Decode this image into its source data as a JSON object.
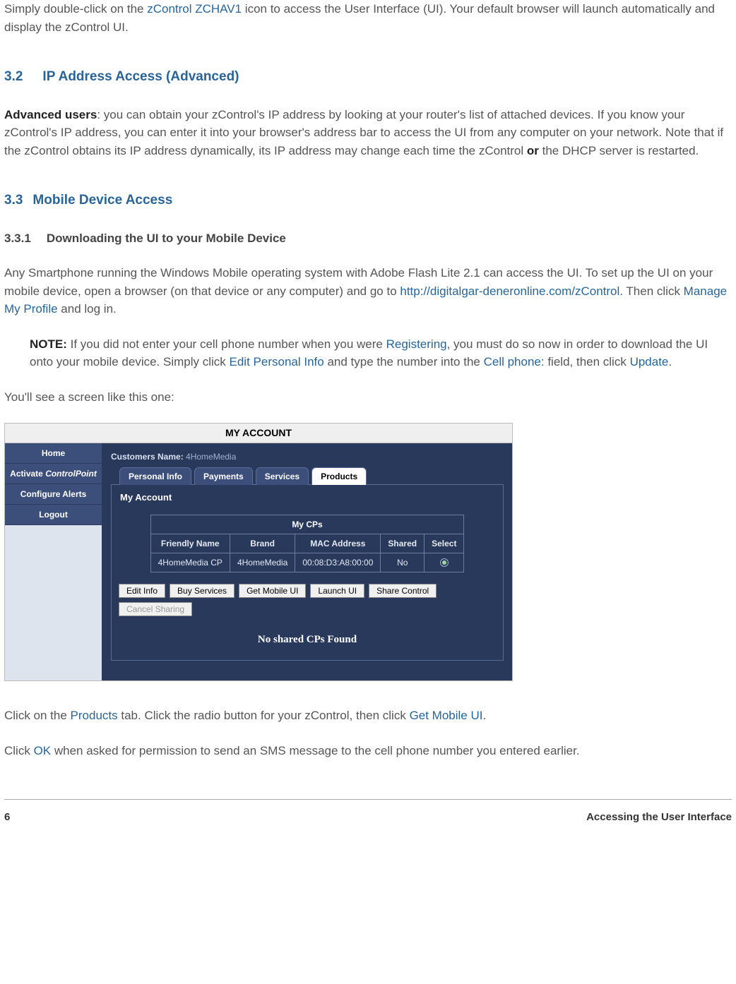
{
  "intro": {
    "pre": "Simply double-click on the ",
    "link": "zControl ZCHAV1",
    "post": " icon to access the User Interface (UI). Your default browser will launch automatically and display the zControl UI."
  },
  "s32": {
    "num": "3.2",
    "title": "IP Address Access (Advanced)",
    "strong": "Advanced users",
    "body1": ": you can obtain your zControl's IP address by looking at your router's list of attached devices. If you know your zControl's IP address, you can enter it into your browser's address bar to access the UI from any computer on your network. Note that if the zControl obtains its IP address dynamically, its IP address may change each time the zControl ",
    "or": "or",
    "body2": " the DHCP server is restarted."
  },
  "s33": {
    "num": "3.3",
    "title": "Mobile Device Access"
  },
  "s331": {
    "num": "3.3.1",
    "title": "Downloading the UI to your Mobile Device",
    "p1a": "Any Smartphone running the Windows Mobile operating system with Adobe Flash Lite 2.1 can access the UI. To set up the UI on your mobile device, open a browser (on that device or any computer) and go to ",
    "url": "http://digitalgar-deneronline.com/zControl.",
    "p1b": " Then click ",
    "manage": "Manage My Profile",
    "p1c": " and log in.",
    "note_label": "NOTE:",
    "note_a": " If you did not enter your cell phone number when you were ",
    "registering": "Registering",
    "note_b": ", you must do so now in order to download the UI onto your mobile device. Simply click ",
    "edit_personal": "Edit Personal Info",
    "note_c": " and type the number into the ",
    "cellphone": "Cell phone:",
    "note_d": " field, then click ",
    "update": "Update",
    "note_e": ".",
    "p2": "You'll see a screen like this one:"
  },
  "shot": {
    "title": "MY ACCOUNT",
    "sidebar": {
      "home": "Home",
      "activate_pre": "Activate ",
      "activate_em": "ControlPoint",
      "configure": "Configure Alerts",
      "logout": "Logout"
    },
    "cust_label": "Customers Name: ",
    "cust_val": "4HomeMedia",
    "tabs": {
      "personal": "Personal Info",
      "payments": "Payments",
      "services": "Services",
      "products": "Products"
    },
    "panel_title": "My Account",
    "table": {
      "caption": "My CPs",
      "headers": {
        "fn": "Friendly Name",
        "brand": "Brand",
        "mac": "MAC Address",
        "shared": "Shared",
        "select": "Select"
      },
      "row": {
        "fn": "4HomeMedia CP",
        "brand": "4HomeMedia",
        "mac": "00:08:D3:A8:00:00",
        "shared": "No"
      }
    },
    "buttons": {
      "edit": "Edit Info",
      "buy": "Buy Services",
      "getmobile": "Get Mobile UI",
      "launch": "Launch UI",
      "share": "Share Control",
      "cancel": "Cancel Sharing"
    },
    "no_shared": "No shared CPs Found"
  },
  "after": {
    "p1a": "Click on the ",
    "products": "Products",
    "p1b": " tab. Click the radio button for your zControl, then click ",
    "getmobile": "Get Mobile UI",
    "p1c": ".",
    "p2a": "Click ",
    "ok": "OK",
    "p2b": " when asked for permission to send an SMS message to the cell phone number you entered earlier."
  },
  "footer": {
    "page": "6",
    "chapter": "Accessing the User Interface"
  }
}
